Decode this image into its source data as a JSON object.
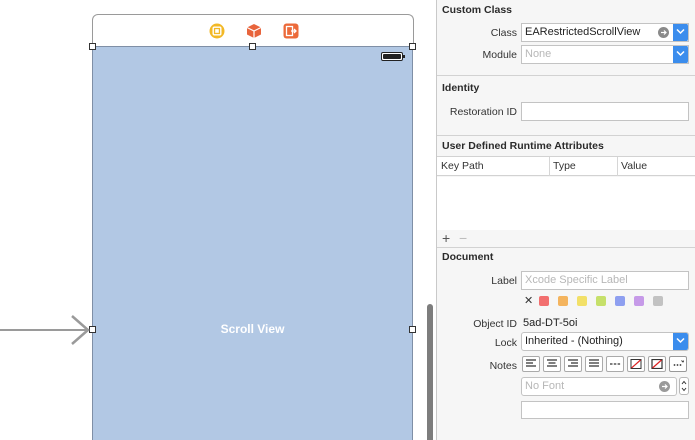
{
  "canvas": {
    "scroll_view_label": "Scroll View"
  },
  "inspector": {
    "custom_class": {
      "title": "Custom Class",
      "class_label": "Class",
      "class_value": "EARestrictedScrollView",
      "module_label": "Module",
      "module_placeholder": "None"
    },
    "identity": {
      "title": "Identity",
      "restoration_id_label": "Restoration ID",
      "restoration_id_value": ""
    },
    "runtime_attributes": {
      "title": "User Defined Runtime Attributes",
      "columns": [
        "Key Path",
        "Type",
        "Value"
      ],
      "add_symbol": "+",
      "remove_symbol": "−"
    },
    "document": {
      "title": "Document",
      "label_label": "Label",
      "label_placeholder": "Xcode Specific Label",
      "clear_color_symbol": "✕",
      "label_colors": [
        "#f26f6f",
        "#f4b45e",
        "#f2e068",
        "#c6e06a",
        "#8e9ff0",
        "#c69ae8",
        "#c2c2c2"
      ],
      "object_id_label": "Object ID",
      "object_id_value": "5ad-DT-5oi",
      "lock_label": "Lock",
      "lock_value": "Inherited - (Nothing)",
      "notes_label": "Notes",
      "font_placeholder": "No Font"
    }
  },
  "colors": {
    "scroll_view_fill": "#b2c8e4",
    "accent": "#3b8ded",
    "vc_icon": "#f2b826",
    "cube_icon": "#e8643c",
    "exit_icon": "#ec6a3a"
  }
}
